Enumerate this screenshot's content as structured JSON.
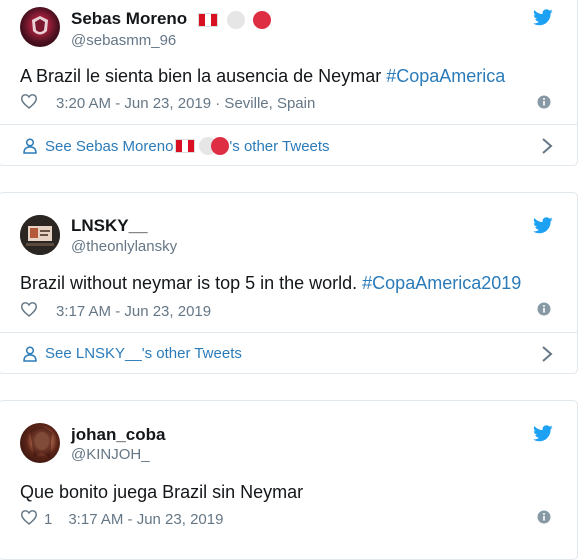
{
  "tweets": [
    {
      "name": "Sebas Moreno",
      "handle": "@sebasmm_96",
      "text": "A Brazil le sienta bien la ausencia de Neymar ",
      "hashtag": "#CopaAmerica",
      "likes": "",
      "meta": "3:20 AM - Jun 23, 2019 · Seville, Spain",
      "footer_prefix": "See Sebas Moreno ",
      "footer_suffix": "'s other Tweets"
    },
    {
      "name": "LNSKY__",
      "handle": "@theonlylansky",
      "text": "Brazil without neymar is top 5 in the world. ",
      "hashtag": "#CopaAmerica2019",
      "likes": "",
      "meta": "3:17 AM - Jun 23, 2019",
      "footer_prefix": "See LNSKY__'s other Tweets",
      "footer_suffix": ""
    },
    {
      "name": "johan_coba",
      "handle": "@KINJOH_",
      "text": "Que bonito juega Brazil sin Neymar",
      "hashtag": "",
      "likes": "1",
      "meta": "3:17 AM - Jun 23, 2019"
    }
  ],
  "icons": [
    "twitter-bird-icon",
    "heart-icon",
    "info-icon",
    "person-icon",
    "chevron-right-icon",
    "peru-flag-icon",
    "white-circle-icon",
    "red-circle-icon"
  ],
  "colors": {
    "link": "#2b7bb9",
    "muted": "#657786",
    "border": "#e1e8ed",
    "text": "#14171a"
  }
}
